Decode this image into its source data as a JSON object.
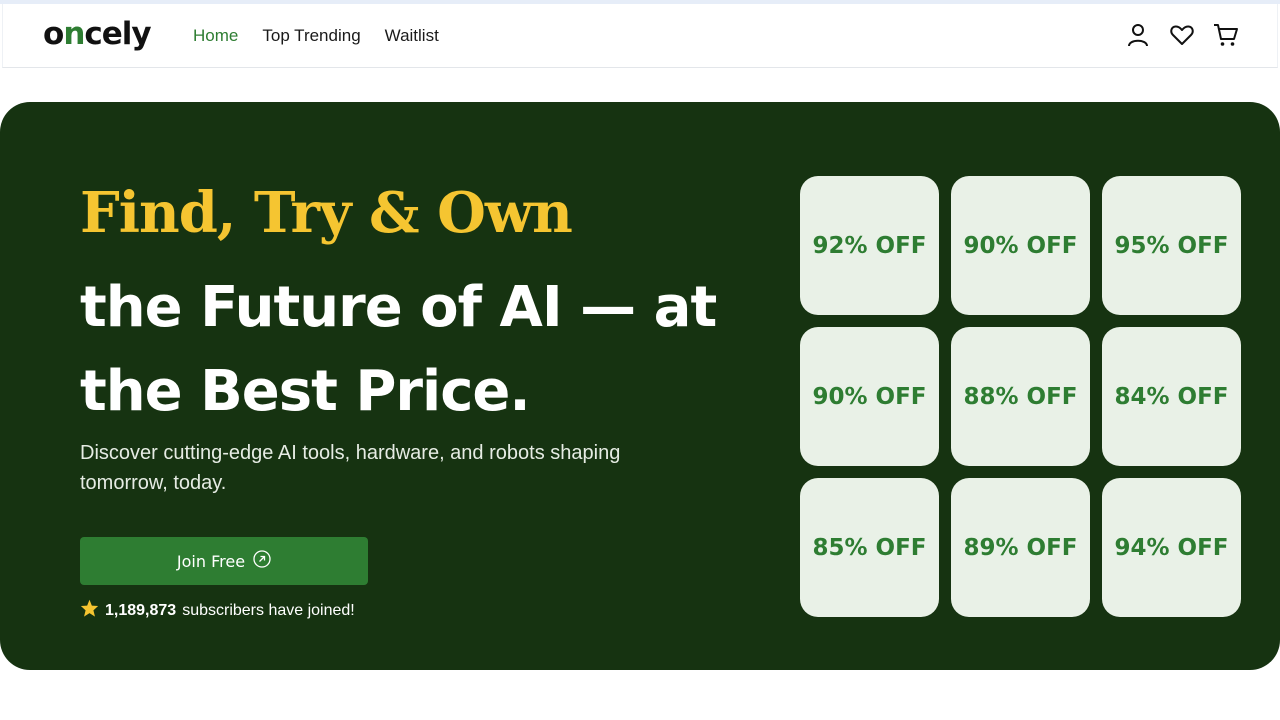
{
  "brand": {
    "logo_prefix": "o",
    "logo_accent": "n",
    "logo_rest": "cely",
    "accent_color": "#2e7d32",
    "dark_color": "#163311",
    "highlight_color": "#f5c531"
  },
  "nav": {
    "items": [
      {
        "label": "Home",
        "active": true
      },
      {
        "label": "Top Trending",
        "active": false
      },
      {
        "label": "Waitlist",
        "active": false
      }
    ]
  },
  "header_icons": [
    "user-icon",
    "heart-icon",
    "cart-icon"
  ],
  "hero": {
    "title_highlight": "Find, Try & Own",
    "title_rest": "the Future of AI — at the Best Price.",
    "subtitle": "Discover cutting-edge AI tools, hardware, and robots shaping tomorrow, today.",
    "cta_label": "Join Free",
    "cta_icon": "arrow-up-right-circle-icon",
    "subscribers_icon": "star-icon",
    "subscribers_count": "1,189,873",
    "subscribers_text": "subscribers have joined!"
  },
  "deals": [
    "92% OFF",
    "90% OFF",
    "95% OFF",
    "90% OFF",
    "88% OFF",
    "84% OFF",
    "85% OFF",
    "89% OFF",
    "94% OFF"
  ]
}
